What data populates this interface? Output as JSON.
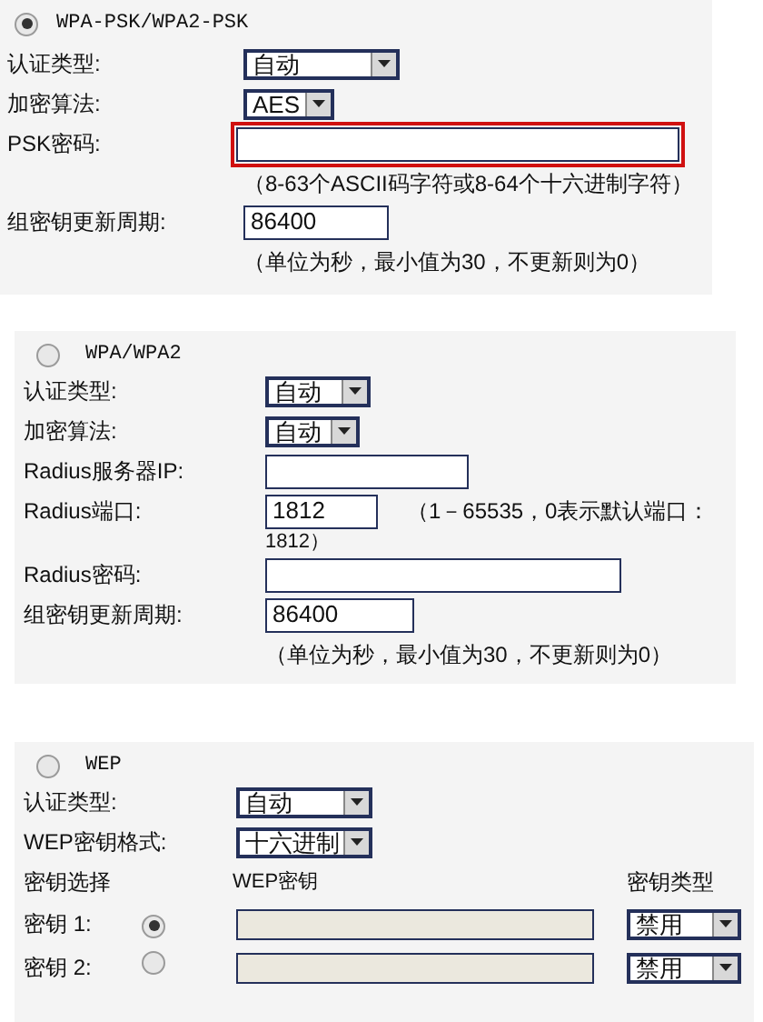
{
  "sections": [
    {
      "radio": {
        "label": "WPA-PSK/WPA2-PSK",
        "selected": true
      },
      "rows": [
        {
          "kind": "select",
          "label": "认证类型:",
          "value": "自动"
        },
        {
          "kind": "select",
          "label": "加密算法:",
          "value": "AES"
        },
        {
          "kind": "input",
          "label": "PSK密码:",
          "value": "",
          "highlighted": true
        },
        {
          "kind": "hint",
          "text": "（8-63个ASCII码字符或8-64个十六进制字符）"
        },
        {
          "kind": "input",
          "label": "组密钥更新周期:",
          "value": "86400",
          "highlighted": false
        },
        {
          "kind": "hint",
          "text": "（单位为秒，最小值为30，不更新则为0）"
        }
      ]
    },
    {
      "radio": {
        "label": "WPA/WPA2",
        "selected": false
      },
      "rows": [
        {
          "kind": "select",
          "label": "认证类型:",
          "value": "自动"
        },
        {
          "kind": "select",
          "label": "加密算法:",
          "value": "自动"
        },
        {
          "kind": "input",
          "label": "Radius服务器IP:",
          "value": "",
          "highlighted": false
        },
        {
          "kind": "input",
          "label": "Radius端口:",
          "value": "1812",
          "highlighted": false,
          "note": "（1－65535，0表示默认端口：",
          "note_cont": "1812）"
        },
        {
          "kind": "input",
          "label": "Radius密码:",
          "value": "",
          "highlighted": false
        },
        {
          "kind": "input",
          "label": "组密钥更新周期:",
          "value": "86400",
          "highlighted": false
        },
        {
          "kind": "hint",
          "text": "（单位为秒，最小值为30，不更新则为0）"
        }
      ]
    },
    {
      "radio": {
        "label": "WEP",
        "selected": false
      },
      "rows": [
        {
          "kind": "select",
          "label": "认证类型:",
          "value": "自动"
        },
        {
          "kind": "select",
          "label": "WEP密钥格式:",
          "value": "十六进制"
        },
        {
          "kind": "key-header",
          "columns": [
            "密钥选择",
            "WEP密钥",
            "密钥类型"
          ]
        },
        {
          "kind": "key",
          "label": "密钥 1:",
          "selected": true,
          "type": "禁用"
        },
        {
          "kind": "key",
          "label": "密钥 2:",
          "selected": false,
          "type": "禁用"
        }
      ]
    }
  ]
}
